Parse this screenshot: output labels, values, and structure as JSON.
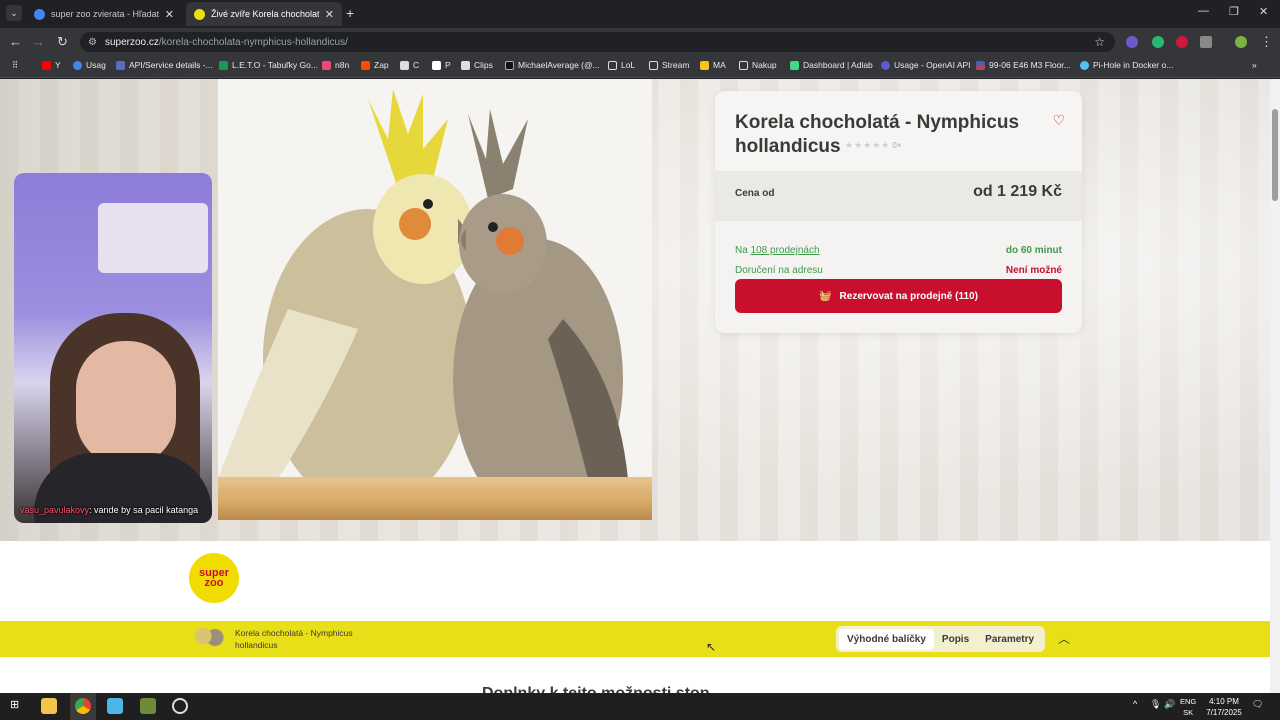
{
  "browser": {
    "tabs": [
      {
        "title": "super zoo zvierata - Hľadať Go",
        "favicon_color": "#4285f4"
      },
      {
        "title": "Živé zvíře Korela chocholatá - N",
        "favicon_color": "#e8df18"
      }
    ],
    "new_tab": "+",
    "close_glyph": "✕",
    "url_domain": "superzoo.cz",
    "url_path": "/korela-chocholata-nymphicus-hollandicus/",
    "bookmarks": [
      "Y",
      "Usag",
      "API/Service details -...",
      "L.E.T.O - Tabuľky Go...",
      "n8n",
      "Zap",
      "C",
      "P",
      "Clips",
      "MichaelAverage (@...",
      "LoL",
      "Stream",
      "MA",
      "Nakup",
      "Dashboard | Adlab",
      "Usage - OpenAI API",
      "99-06 E46 M3 Floor...",
      "Pi-Hole in Docker o..."
    ],
    "bookmarks_more": "»"
  },
  "webcam": {
    "chat_user": "vasu_pavulakovy",
    "chat_message": ": vande by sa pacil katanga"
  },
  "product": {
    "title": "Korela chocholatá - Nymphicus hollandicus",
    "rating_stars": "★★★★★",
    "rating_count": "0×",
    "price_label": "Cena od",
    "price": "od 1 219 Kč",
    "stores_prefix": "Na ",
    "stores_link": "108 prodejnách",
    "stores_time": "do 60 minut",
    "delivery_label": "Doručení na adresu",
    "delivery_status": "Není možné",
    "cta_label": "Rezervovat na prodejně (110)"
  },
  "logo": {
    "line1": "super",
    "line2": "zoo"
  },
  "sticky": {
    "name": "Korela chocholatá - Nymphicus hollandicus",
    "tabs": [
      "Výhodné balíčky",
      "Popis",
      "Parametry"
    ],
    "active_tab": "Výhodné balíčky"
  },
  "below_heading": "Doplnky k tejto možnosti stop",
  "taskbar": {
    "lang_line1": "ENG",
    "lang_line2": "SK",
    "time": "4:10 PM",
    "date": "7/17/2025"
  }
}
